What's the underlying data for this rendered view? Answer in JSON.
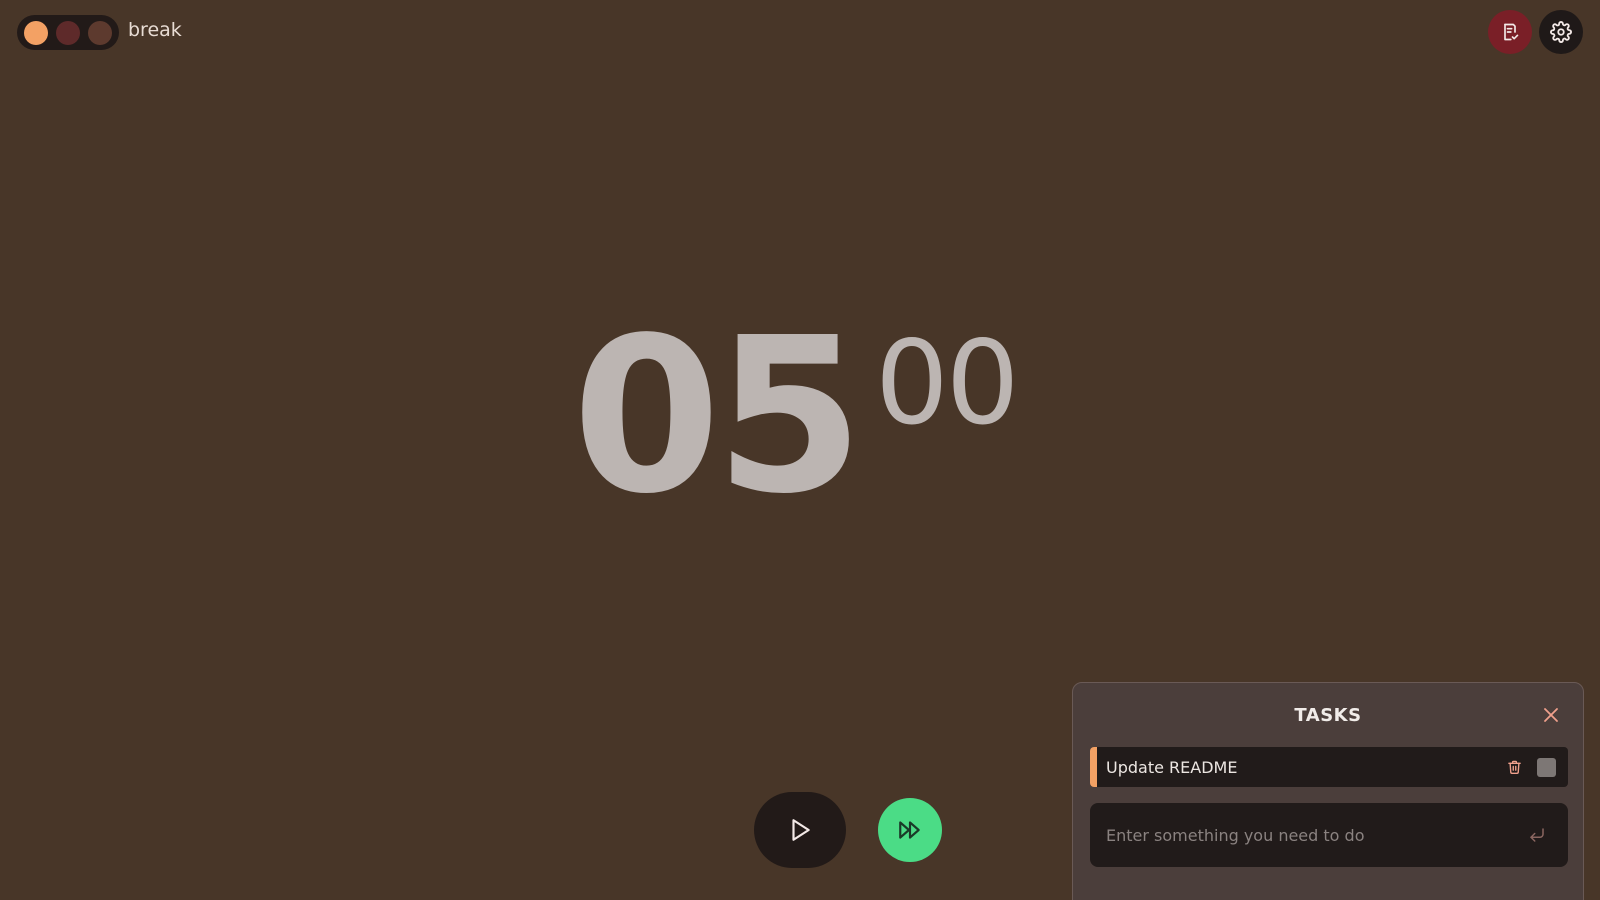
{
  "mode": {
    "label": "break",
    "dots": [
      {
        "name": "mode-dot-break",
        "color": "#f3a164"
      },
      {
        "name": "mode-dot-focus",
        "color": "#5e2a2a"
      },
      {
        "name": "mode-dot-long-break",
        "color": "#5d3a2e"
      }
    ]
  },
  "toolbar": {
    "tasks_icon": "checklist-icon",
    "settings_icon": "gear-icon"
  },
  "timer": {
    "minutes": "05",
    "seconds": "00"
  },
  "controls": {
    "play_icon": "play-icon",
    "skip_icon": "fast-forward-icon"
  },
  "tasks": {
    "title": "TASKS",
    "items": [
      {
        "label": "Update README",
        "accent": "#f3a164"
      }
    ],
    "input_placeholder": "Enter something you need to do"
  },
  "colors": {
    "background": "#483628",
    "accent": "#f3a164",
    "skip": "#4bdc86",
    "tasks_button": "#7a1f27"
  }
}
